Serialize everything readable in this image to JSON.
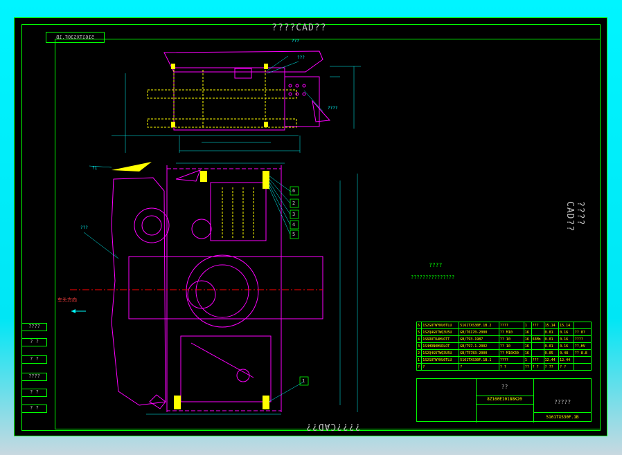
{
  "watermark": {
    "top": "????CAD??",
    "bottom": "????CAD??",
    "right": "????CAD??"
  },
  "drawing_code_box": "5161TXS30F.1B",
  "note_title": "????",
  "note_text": "???????????????",
  "direction_label": "车头方向",
  "callouts": [
    "6",
    "2",
    "3",
    "4",
    "5",
    "1"
  ],
  "annotations": {
    "a1": "???",
    "a2": "???",
    "a3": "????",
    "a4": "???",
    "a5": "?1"
  },
  "bom": [
    [
      "6",
      "1S2GUTWYKU0TLU",
      "5161TXS30F.1B.2",
      "????",
      "1",
      "???",
      "15.14",
      "15.14"
    ],
    [
      "5",
      "1S2Q4GUTWQ3U5U",
      "GB/T6170-2000",
      "?? M10",
      "16",
      "",
      "0.01",
      "0.16",
      "?? 8?"
    ],
    [
      "4",
      "1S6RUTUAHUOTT",
      "GB/T93-1987",
      "?? 10",
      "16",
      "65Mn",
      "0.01",
      "0.16",
      "????"
    ],
    [
      "3",
      "1S4HDN0HUDLOT",
      "GB/T97.1-2002",
      "?? 10",
      "16",
      "",
      "0.01",
      "0.16",
      "??,HV"
    ],
    [
      "2",
      "1S2Q4GUTWQ3U5U",
      "GB/T5783-2000",
      "?? M10X30",
      "16",
      "",
      "0.05",
      "0.48",
      "?? 8.8"
    ],
    [
      "1",
      "1S2GUTWYKU0TLU",
      "5161TXS30F.1B.1",
      "????",
      "1",
      "???",
      "12.44",
      "12.44"
    ],
    [
      "?",
      "?",
      "?",
      "? ?",
      "??",
      "? ?",
      "? ??",
      "? ?"
    ]
  ],
  "title_block": {
    "drawing_no": "8Z160E10188K20",
    "name": "?????",
    "code": "5161TXS30F.1B",
    "label_q": "??"
  },
  "left_strip": [
    "????",
    "? ?",
    "? ?",
    "????",
    "? ?",
    "? ?"
  ]
}
